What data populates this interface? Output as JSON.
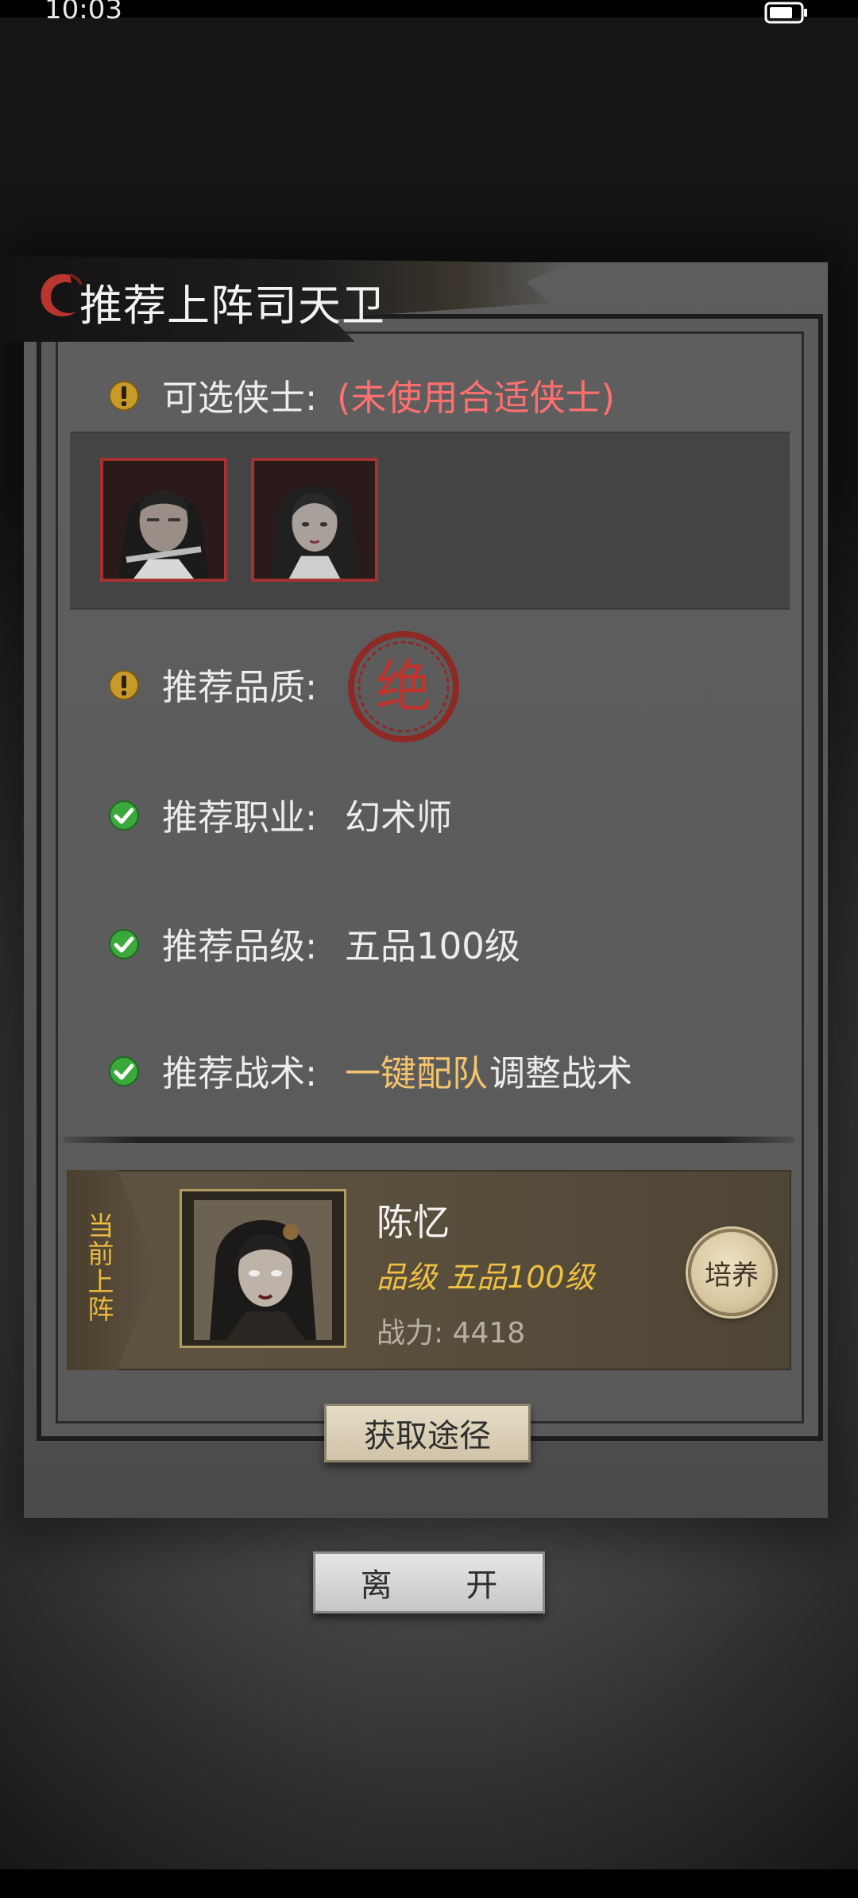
{
  "status_bar": {
    "time": "10:03"
  },
  "dialog": {
    "title": "推荐上阵司天卫",
    "optional_heroes": {
      "label": "可选侠士:",
      "note": "(未使用合适侠士)"
    },
    "quality": {
      "label": "推荐品质:",
      "seal_char": "绝"
    },
    "profession": {
      "label": "推荐职业:",
      "value": "幻术师"
    },
    "grade": {
      "label": "推荐品级:",
      "value": "五品100级"
    },
    "tactics": {
      "label": "推荐战术:",
      "link": "一键配队",
      "rest": "调整战术"
    },
    "current_lineup": {
      "tag": "当前上阵",
      "name": "陈忆",
      "grade": "品级 五品100级",
      "power": "战力: 4418",
      "train_label": "培养"
    },
    "obtain_button": "获取途径"
  },
  "leave_button": "离 开",
  "colors": {
    "warning": "#c79a2a",
    "check": "#3aa83a",
    "red_note": "#ff6f6f",
    "gold": "#f3c46c",
    "seal_red": "#b2302c"
  }
}
